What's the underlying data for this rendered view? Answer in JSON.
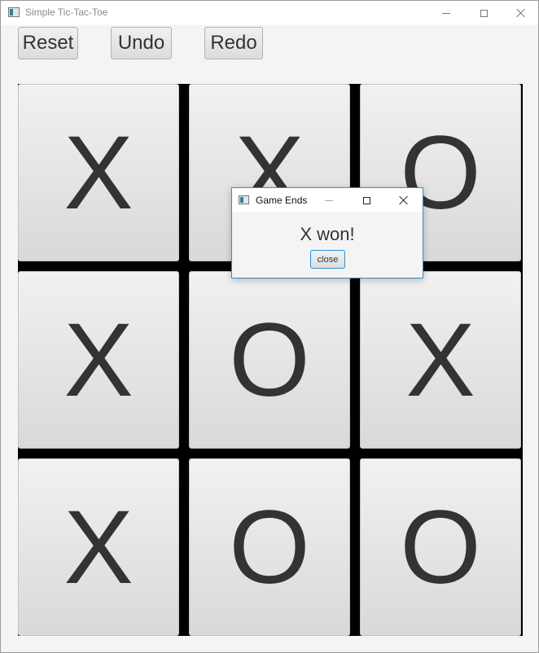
{
  "window": {
    "title": "Simple Tic-Tac-Toe",
    "icon": "app-window-icon",
    "controls": [
      "minimize-icon",
      "maximize-icon",
      "close-icon"
    ]
  },
  "toolbar": {
    "reset_label": "Reset",
    "undo_label": "Undo",
    "redo_label": "Redo"
  },
  "board": {
    "cells": [
      [
        "X",
        "X",
        "O"
      ],
      [
        "X",
        "O",
        "X"
      ],
      [
        "X",
        "O",
        "O"
      ]
    ]
  },
  "dialog": {
    "title": "Game Ends",
    "message": "X won!",
    "close_label": "close"
  },
  "colors": {
    "background": "#f4f4f4",
    "grid_lines": "#000000",
    "cell_text": "#333333",
    "dialog_accent": "#2d8fd5"
  }
}
